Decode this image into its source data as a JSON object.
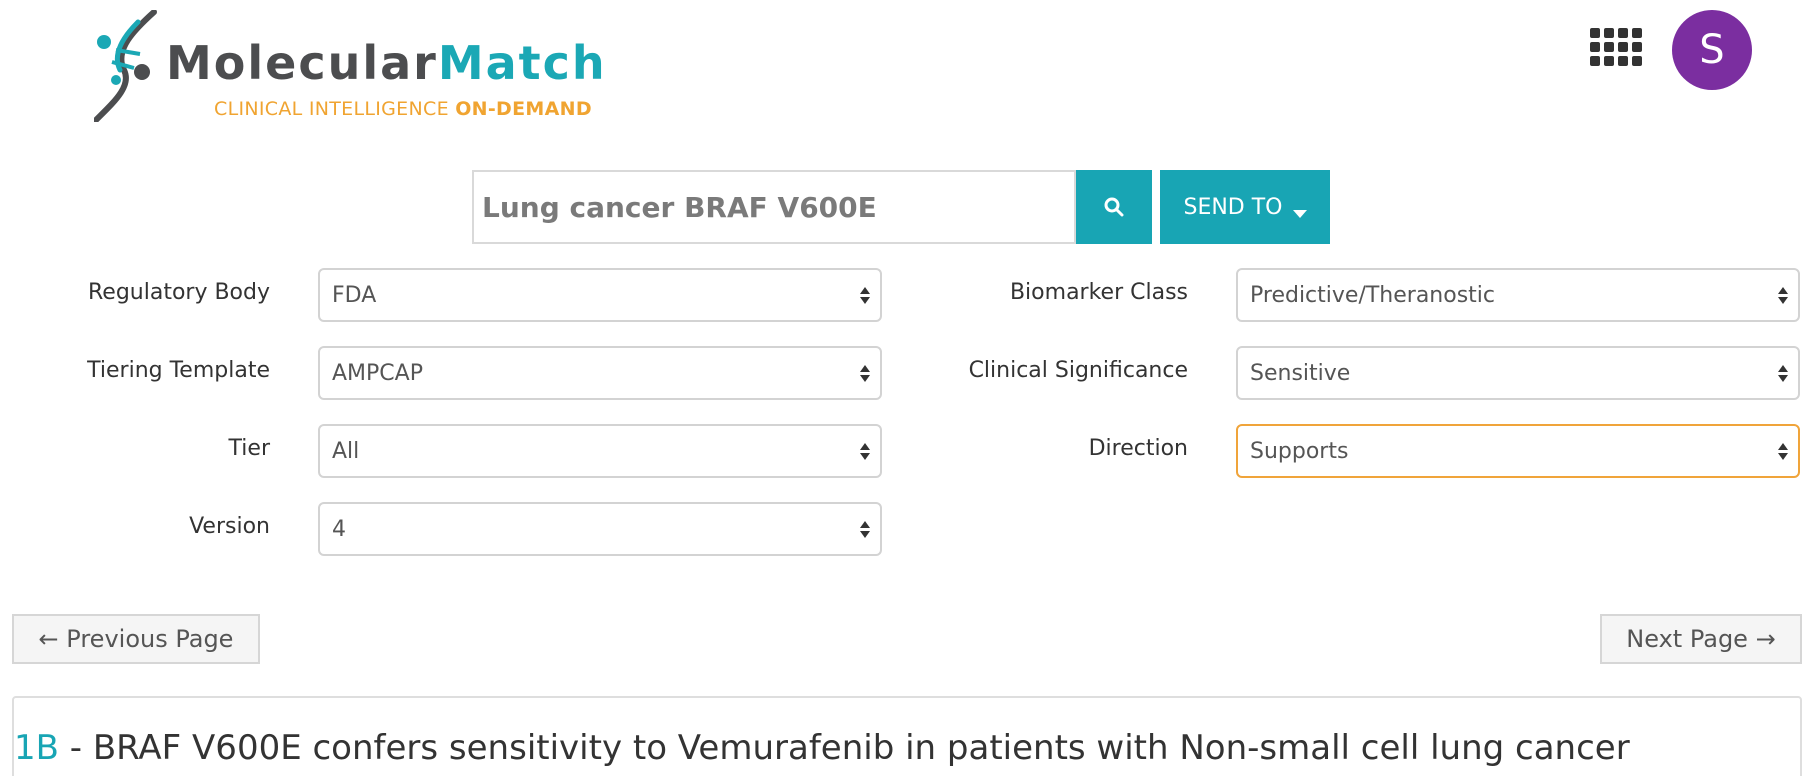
{
  "brand": {
    "name_part1": "Molecular",
    "name_part2": "Match",
    "tagline_part1": "CLINICAL INTELLIGENCE ",
    "tagline_part2": "ON-DEMAND",
    "colors": {
      "dark": "#4c4d4f",
      "teal": "#1ba8b5",
      "orange": "#f0a431"
    }
  },
  "header": {
    "apps_icon": "apps-grid-icon",
    "avatar_initial": "S",
    "avatar_color": "#7b2ea0"
  },
  "search": {
    "value": "Lung cancer BRAF V600E",
    "search_icon": "search-icon",
    "send_to_label": "SEND TO",
    "accent": "#18a5b4"
  },
  "filters": {
    "regulatory_body": {
      "label": "Regulatory Body",
      "value": "FDA"
    },
    "tiering_template": {
      "label": "Tiering Template",
      "value": "AMPCAP"
    },
    "tier": {
      "label": "Tier",
      "value": "All"
    },
    "version": {
      "label": "Version",
      "value": "4"
    },
    "biomarker_class": {
      "label": "Biomarker Class",
      "value": "Predictive/Theranostic"
    },
    "clinical_significance": {
      "label": "Clinical Significance",
      "value": "Sensitive"
    },
    "direction": {
      "label": "Direction",
      "value": "Supports"
    }
  },
  "pager": {
    "previous_label": "← Previous Page",
    "next_label": "Next Page →"
  },
  "result": {
    "tier": "1B",
    "title": " - BRAF V600E confers sensitivity to Vemurafenib in patients with Non-small cell lung cancer"
  }
}
